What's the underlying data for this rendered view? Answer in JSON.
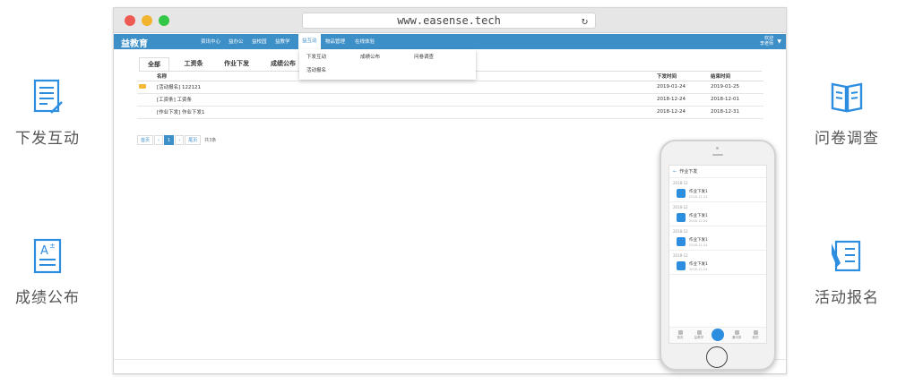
{
  "features": {
    "left_top": {
      "label": "下发互动",
      "icon": "edit-document-icon"
    },
    "left_bottom": {
      "label": "成绩公布",
      "icon": "grade-document-icon"
    },
    "right_top": {
      "label": "问卷调查",
      "icon": "open-book-icon"
    },
    "right_bottom": {
      "label": "活动报名",
      "icon": "signup-pen-icon"
    }
  },
  "colors": {
    "accent": "#3d8fc7",
    "feature_icon": "#2d8ee0",
    "feature_text": "#555555"
  },
  "browser": {
    "url": "www.easense.tech",
    "app": {
      "brand": "益教育",
      "nav": [
        "资讯中心",
        "益办公",
        "益校园",
        "益教学",
        "益互动",
        "物品管理",
        "在线体验"
      ],
      "active_nav": "益互动",
      "user_line1": "欢迎",
      "user_line2": "李老师"
    },
    "dropdown": [
      "下发互动",
      "成绩公布",
      "问卷调查",
      "活动报名"
    ],
    "tabs": [
      "全部",
      "工资条",
      "作业下发",
      "成绩公布"
    ],
    "table": {
      "headers": [
        "名称",
        "下发时间",
        "结束时间"
      ],
      "rows": [
        {
          "name": "[活动报名]   122121",
          "start": "2019-01-24",
          "end": "2019-01-25",
          "unread": true
        },
        {
          "name": "[工资条]   工资条",
          "start": "2018-12-24",
          "end": "2018-12-01",
          "unread": false
        },
        {
          "name": "[作业下发]   作业下发1",
          "start": "2018-12-24",
          "end": "2018-12-31",
          "unread": false
        }
      ]
    },
    "pager": {
      "first": "首页",
      "prev": "‹",
      "current": "1",
      "next": "›",
      "last": "尾页",
      "total": "共3条"
    }
  },
  "phone": {
    "title": "作业下发",
    "groups": [
      {
        "date": "2018-12",
        "title": "作业下发1",
        "sub": "2018-12-24"
      },
      {
        "date": "2018-12",
        "title": "作业下发1",
        "sub": "2018-12-24"
      },
      {
        "date": "2018-12",
        "title": "作业下发1",
        "sub": "2018-12-24"
      },
      {
        "date": "2018-12",
        "title": "作业下发1",
        "sub": "2018-12-24"
      }
    ],
    "tabbar": [
      "首页",
      "益教学",
      "",
      "通讯录",
      "我的"
    ]
  }
}
